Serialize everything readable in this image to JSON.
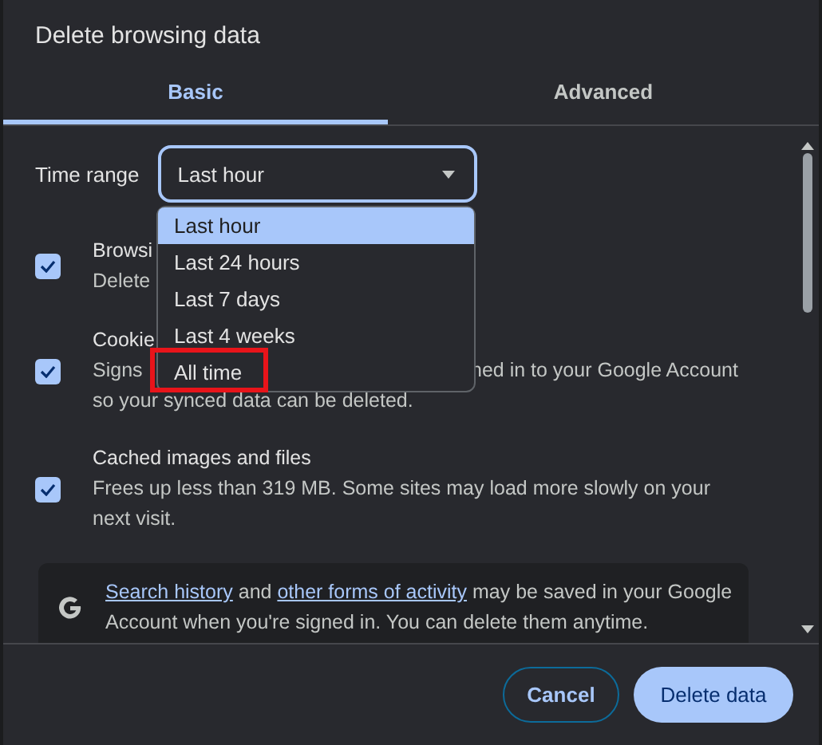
{
  "dialog": {
    "title": "Delete browsing data",
    "tabs": [
      {
        "label": "Basic",
        "selected": true
      },
      {
        "label": "Advanced",
        "selected": false
      }
    ],
    "time_range": {
      "label": "Time range",
      "value": "Last hour",
      "expanded": true,
      "options": [
        {
          "label": "Last hour",
          "selected": true,
          "marked": false
        },
        {
          "label": "Last 24 hours",
          "selected": false,
          "marked": false
        },
        {
          "label": "Last 7 days",
          "selected": false,
          "marked": false
        },
        {
          "label": "Last 4 weeks",
          "selected": false,
          "marked": false
        },
        {
          "label": "All time",
          "selected": false,
          "marked": true
        }
      ]
    },
    "items": [
      {
        "checked": true,
        "title": "Browsi",
        "lines": [
          [
            "Delete"
          ]
        ]
      },
      {
        "checked": true,
        "title": "Cookie",
        "lines": [
          [
            "Signs",
            "ned in to your Google Account"
          ],
          [
            "so your synced data can be deleted."
          ]
        ]
      },
      {
        "checked": true,
        "title": "Cached images and files",
        "lines": [
          [
            "Frees up less than 319 MB. Some sites may load more slowly on your"
          ],
          [
            "next visit."
          ]
        ]
      }
    ],
    "info": {
      "segments": [
        {
          "text": "Search history",
          "kind": "link"
        },
        {
          "text": " and ",
          "kind": "plain"
        },
        {
          "text": "other forms of activity",
          "kind": "link"
        },
        {
          "text": " may be saved in your Google Account when you're signed in. You can delete them anytime.",
          "kind": "plain"
        }
      ]
    },
    "buttons": [
      {
        "label": "Cancel",
        "kind": "outlined"
      },
      {
        "label": "Delete data",
        "kind": "filled"
      }
    ]
  }
}
